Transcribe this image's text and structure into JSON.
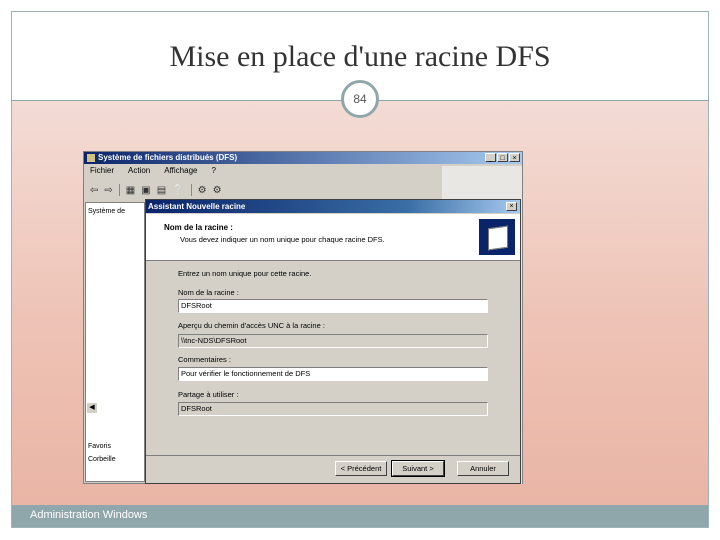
{
  "slide": {
    "title": "Mise en place d'une racine DFS",
    "page_number": "84",
    "footer": "Administration Windows"
  },
  "back_window": {
    "title": "Système de fichiers distribués (DFS)",
    "controls": [
      "_",
      "□",
      "×"
    ],
    "menu": [
      "Fichier",
      "Action",
      "Affichage",
      "?"
    ],
    "toolbar_icons": [
      "back-arrow-icon",
      "forward-arrow-icon",
      "show-hide-tree-icon",
      "properties-icon",
      "export-list-icon",
      "help-icon",
      "dfs-icon"
    ],
    "tree_items": [
      "Système de",
      "Favoris",
      "Corbeille"
    ]
  },
  "dialog": {
    "title": "Assistant Nouvelle racine",
    "close": "×",
    "header_title": "Nom de la racine :",
    "header_subtitle": "Vous devez indiquer un nom unique pour chaque racine DFS.",
    "intro": "Entrez un nom unique pour cette racine.",
    "fields": {
      "root_name_label": "Nom de la racine :",
      "root_name_value": "DFSRoot",
      "path_label": "Aperçu du chemin d'accès UNC à la racine :",
      "path_value": "\\\\tnc-NDS\\DFSRoot",
      "comment_label": "Commentaires :",
      "comment_value": "Pour vérifier le fonctionnement de DFS",
      "share_label": "Partage à utiliser :",
      "share_value": "DFSRoot"
    },
    "buttons": {
      "back": "< Précédent",
      "next": "Suivant >",
      "cancel": "Annuler"
    }
  }
}
